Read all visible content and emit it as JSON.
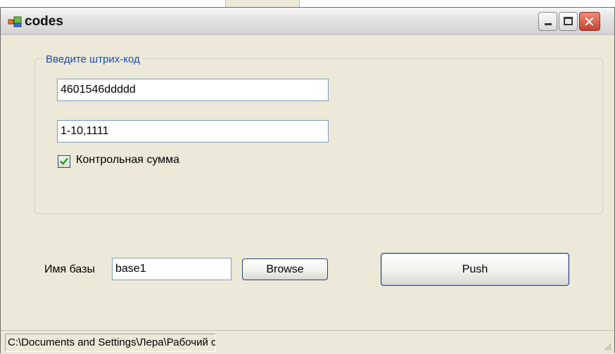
{
  "window": {
    "title": "codes",
    "icon": "app-icon",
    "controls": [
      "minimize-icon",
      "maximize-icon",
      "close-icon"
    ]
  },
  "group": {
    "legend": "Введите штрих-код",
    "barcode_value": "4601546ddddd",
    "range_value": "1-10,1111",
    "checksum_label": "Контрольная сумма",
    "checksum_checked": true
  },
  "base": {
    "label": "Имя базы",
    "value": "base1",
    "browse_label": "Browse"
  },
  "push_label": "Push",
  "statusbar": {
    "path": "C:\\Documents and Settings\\Лера\\Рабочий стол"
  },
  "colors": {
    "face": "#ece9d8",
    "legend_text": "#1d4ab3",
    "textbox_border": "#7f9db9",
    "close_button": "#c8422e"
  }
}
